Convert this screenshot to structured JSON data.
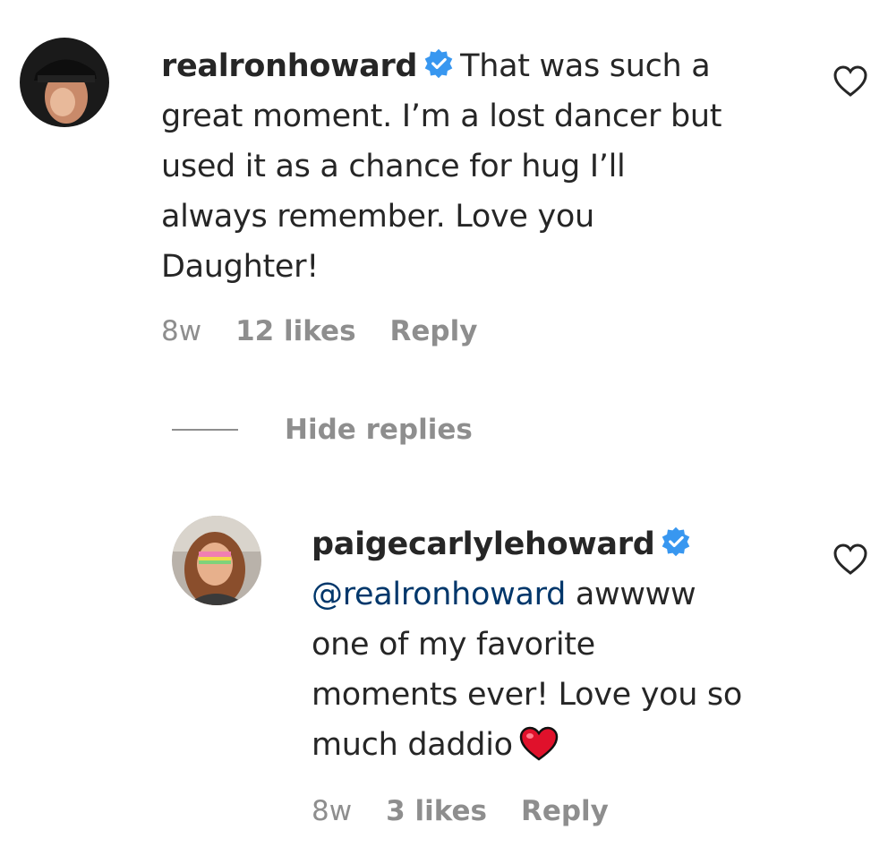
{
  "comments": [
    {
      "username": "realronhoward",
      "text_lines": [
        "That was such a",
        "great moment. I’m a lost dancer but",
        "used it as a chance for hug I’ll",
        "always remember. Love you",
        "Daughter!"
      ],
      "time": "8w",
      "likes": "12 likes",
      "reply_label": "Reply",
      "verified_icon": "verified-badge-icon",
      "like_icon": "heart-outline-icon"
    }
  ],
  "replies_toggle": {
    "label": "Hide replies"
  },
  "replies": [
    {
      "username": "paigecarlylehoward",
      "mention": "@realronhoward",
      "text_lines": [
        "awwww",
        "one of my favorite",
        "moments ever! Love you so",
        "much daddio"
      ],
      "emoji": "red-heart-emoji",
      "time": "8w",
      "likes": "3 likes",
      "reply_label": "Reply",
      "verified_icon": "verified-badge-icon",
      "like_icon": "heart-outline-icon"
    }
  ],
  "colors": {
    "text": "#262626",
    "muted": "#8e8e8e",
    "verified": "#3897f0",
    "mention": "#00376b",
    "heart": "#e0112b"
  }
}
